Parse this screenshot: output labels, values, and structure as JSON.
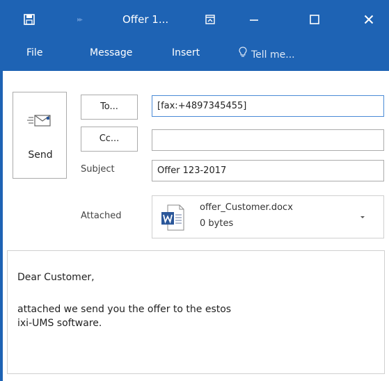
{
  "window": {
    "title": "Offer 1..."
  },
  "ribbon": {
    "tabs": [
      {
        "label": "File"
      },
      {
        "label": "Message"
      },
      {
        "label": "Insert"
      }
    ],
    "tell_me": "Tell me..."
  },
  "compose": {
    "send_label": "Send",
    "to_button": "To...",
    "cc_button": "Cc...",
    "to_value": "[fax:+4897345455]",
    "cc_value": "",
    "subject_label": "Subject",
    "subject_value": "Offer 123-2017",
    "attached_label": "Attached",
    "attachment": {
      "name": "offer_Customer.docx",
      "size": "0 bytes"
    },
    "body": {
      "greeting": "Dear Customer,",
      "text": "attached we send you the offer to the estos ixi-UMS software."
    }
  },
  "colors": {
    "accent": "#1e63b4",
    "word_blue": "#2b579a"
  }
}
